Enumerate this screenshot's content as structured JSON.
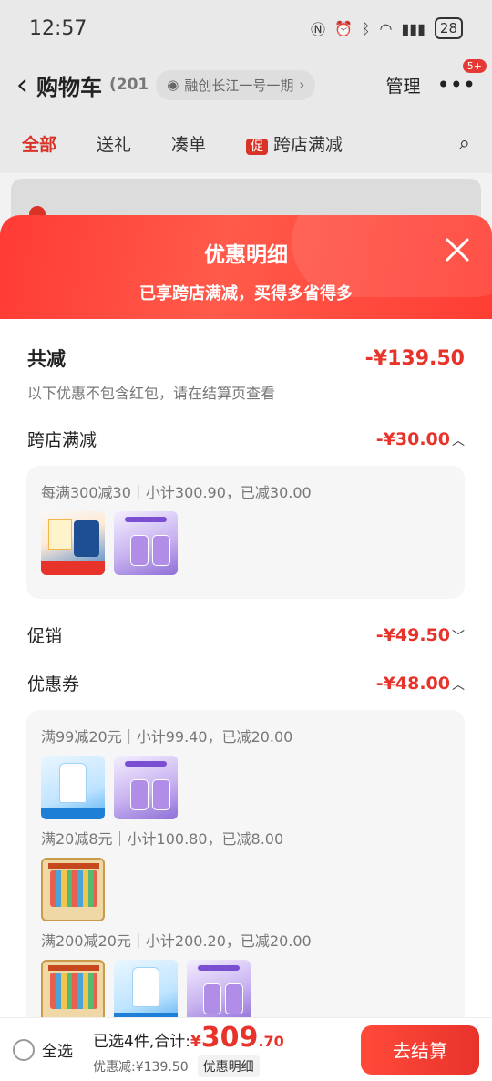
{
  "status_bar": {
    "time": "12:57",
    "battery": "28"
  },
  "header": {
    "title": "购物车",
    "count": "(201",
    "location": "融创长江一号一期",
    "manage": "管理",
    "badge": "5+"
  },
  "tabs": [
    {
      "label": "全部",
      "active": true
    },
    {
      "label": "送礼"
    },
    {
      "label": "凑单"
    },
    {
      "label": "跨店满减",
      "badge": "促"
    }
  ],
  "modal": {
    "title": "优惠明细",
    "subtitle": "已享跨店满减，买得多省得多",
    "total": {
      "label": "共减",
      "amount": "-¥139.50",
      "note": "以下优惠不包含红包，请在结算页查看"
    },
    "sections": {
      "cross_store": {
        "label": "跨店满减",
        "amount": "-¥30.00",
        "rules": [
          "每满300减30｜小计300.90，已减30.00"
        ]
      },
      "promo": {
        "label": "促销",
        "amount": "-¥49.50"
      },
      "coupon": {
        "label": "优惠券",
        "amount": "-¥48.00",
        "rules": [
          "满99减20元｜小计99.40，已减20.00",
          "满20减8元｜小计100.80，已减8.00",
          "满200减20元｜小计200.20，已减20.00"
        ]
      }
    }
  },
  "bottom_bar": {
    "select_all": "全选",
    "selected_label": "已选4件,合计:",
    "currency": "¥",
    "price_int": "309",
    "price_dec": ".70",
    "discount": "优惠减:¥139.50",
    "detail_link": "优惠明细",
    "checkout": "去结算"
  },
  "colors": {
    "accent": "#e8332b",
    "header_gradient": "#ff3b34"
  },
  "icons": [
    "back-icon",
    "eye-icon",
    "more-icon",
    "search-icon",
    "close-icon",
    "chevron-up-icon",
    "chevron-down-icon"
  ]
}
